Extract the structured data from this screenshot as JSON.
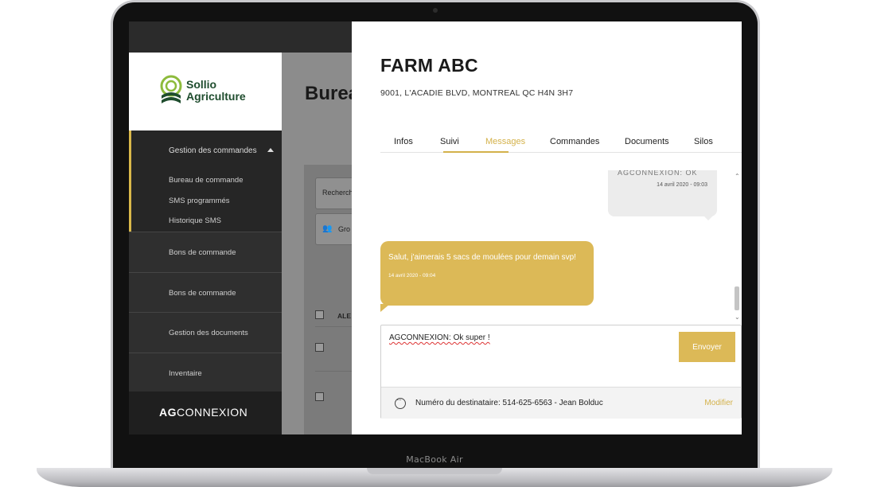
{
  "device": {
    "label": "MacBook Air"
  },
  "sidebar": {
    "logo_line1": "Sollio",
    "logo_line2": "Agriculture",
    "section": {
      "label": "Gestion des commandes",
      "items": [
        "Bureau de commande",
        "SMS programmés",
        "Historique SMS"
      ]
    },
    "items": [
      "Bons de commande",
      "Bons de commande",
      "Gestion des documents",
      "Inventaire"
    ],
    "brand_bold": "AG",
    "brand_rest": "CONNEXION"
  },
  "background_page": {
    "title": "Burea",
    "search_placeholder": "Recherch",
    "group_label": "Gro",
    "column_head": "ALE"
  },
  "farm": {
    "title": "FARM ABC",
    "address": "9001, L'ACADIE BLVD, MONTREAL QC H4N 3H7"
  },
  "tabs": [
    {
      "label": "Infos"
    },
    {
      "label": "Suivi"
    },
    {
      "label": "Messages",
      "active": true
    },
    {
      "label": "Commandes"
    },
    {
      "label": "Documents"
    },
    {
      "label": "Silos"
    }
  ],
  "messages": {
    "incoming": {
      "partial_text": "AGCONNEXION: OK",
      "timestamp": "14 avril 2020 - 09:03"
    },
    "outgoing": {
      "text": "Salut, j'aimerais 5 sacs de moulées pour demain svp!",
      "timestamp": "14 avril 2020 - 09:04"
    }
  },
  "compose": {
    "text": "AGCONNEXION: Ok super !",
    "send_label": "Envoyer"
  },
  "recipient": {
    "label": "Numéro du destinataire:  514-625-6563 - Jean Bolduc",
    "modify_label": "Modifier"
  },
  "colors": {
    "accent": "#dcb957",
    "sidebar": "#2f2f2f",
    "logo_green": "#1f4d2e"
  }
}
